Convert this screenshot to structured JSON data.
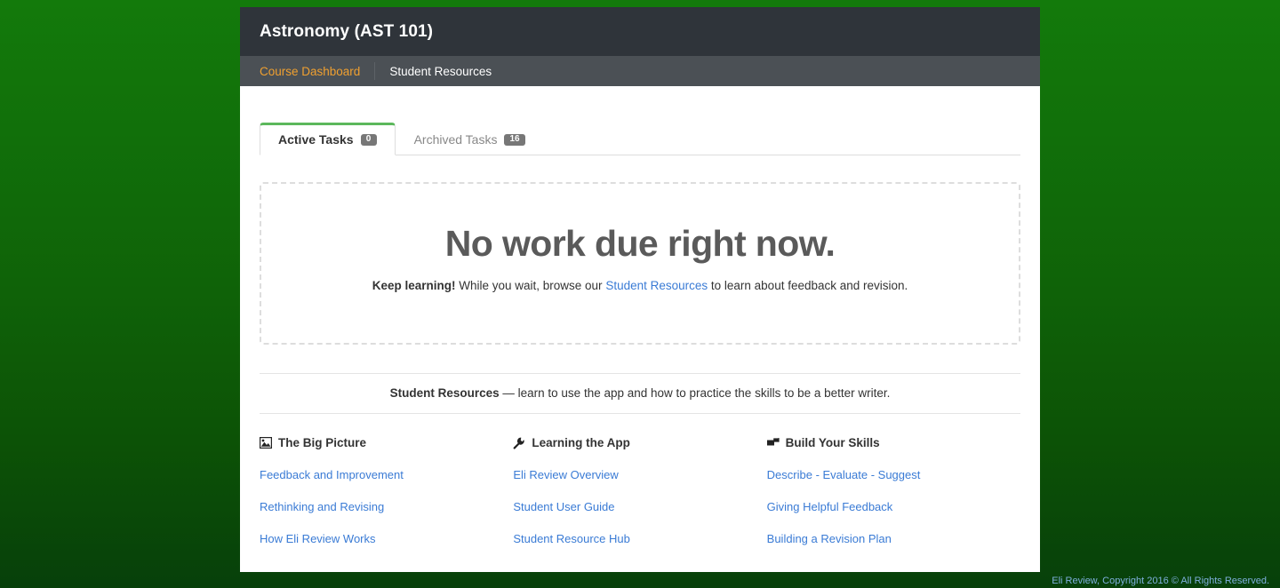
{
  "header": {
    "title": "Astronomy (AST 101)",
    "nav": [
      {
        "label": "Course Dashboard",
        "active": true
      },
      {
        "label": "Student Resources",
        "active": false
      }
    ]
  },
  "tabs": [
    {
      "label": "Active Tasks",
      "badge": "0",
      "active": true
    },
    {
      "label": "Archived Tasks",
      "badge": "16",
      "active": false
    }
  ],
  "empty_state": {
    "headline": "No work due right now.",
    "sub_bold": "Keep learning!",
    "sub_before_link": " While you wait, browse our ",
    "sub_link": "Student Resources",
    "sub_after_link": " to learn about feedback and revision."
  },
  "resources_divider": {
    "bold": "Student Resources",
    "rest": " — learn to use the app and how to practice the skills to be a better writer."
  },
  "resource_columns": [
    {
      "icon": "picture-icon",
      "title": "The Big Picture",
      "links": [
        "Feedback and Improvement",
        "Rethinking and Revising",
        "How Eli Review Works"
      ]
    },
    {
      "icon": "wrench-icon",
      "title": "Learning the App",
      "links": [
        "Eli Review Overview",
        "Student User Guide",
        "Student Resource Hub"
      ]
    },
    {
      "icon": "bullhorn-icon",
      "title": "Build Your Skills",
      "links": [
        "Describe - Evaluate - Suggest",
        "Giving Helpful Feedback",
        "Building a Revision Plan"
      ]
    }
  ],
  "footer": {
    "text": "Eli Review, Copyright 2016 © All Rights Reserved."
  },
  "colors": {
    "titlebar": "#2f343a",
    "navbar": "#4b5055",
    "nav_active": "#f0a030",
    "tab_accent": "#5cb85c",
    "link": "#3a7bd5",
    "badge": "#777777",
    "page_bg_top": "#137a0b",
    "page_bg_bottom": "#07400a"
  }
}
